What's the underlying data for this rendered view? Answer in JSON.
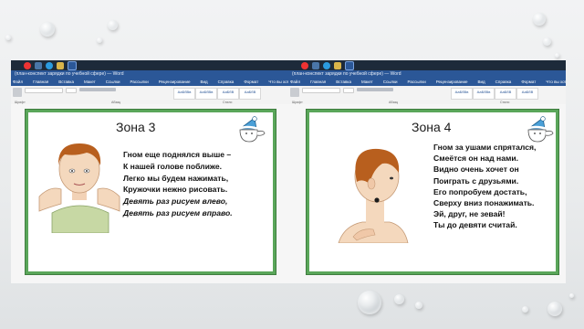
{
  "left": {
    "window_title": "(план-конспект зарядки по учебной сфере) — Word",
    "menu": [
      "Файл",
      "Главная",
      "Вставка",
      "Макет",
      "Ссылки",
      "Рассылки",
      "Рецензирование",
      "Вид",
      "Справка",
      "Формат",
      "Что вы хотите сделать?"
    ],
    "ribbon_groups": [
      "Шрифт",
      "Абзац",
      "Стили"
    ],
    "styles": [
      "АаБбВв",
      "АаБбВв",
      "АаБбВ",
      "АаБбВ"
    ],
    "zone_title": "Зона 3",
    "poem": [
      "Гном еще поднялся выше –",
      "К нашей голове поближе.",
      "Легко мы будем нажимать,",
      "Кружочки нежно рисовать."
    ],
    "poem_italic": [
      "Девять раз рисуем влево,",
      "Девять раз рисуем вправо."
    ]
  },
  "right": {
    "window_title": "(план-конспект зарядки по учебной сфере) — Word",
    "menu": [
      "Файл",
      "Главная",
      "Вставка",
      "Макет",
      "Ссылки",
      "Рассылки",
      "Рецензирование",
      "Вид",
      "Справка",
      "Формат",
      "Что вы хотите сделать?"
    ],
    "ribbon_groups": [
      "Шрифт",
      "Абзац",
      "Стили"
    ],
    "styles": [
      "АаБбВв",
      "АаБбВв",
      "АаБбВ",
      "АаБбВ"
    ],
    "zone_title": "Зона 4",
    "poem": [
      "Гном за ушами спрятался,",
      "Смеётся он над нами.",
      "Видно очень хочет он",
      "Поиграть с друзьями.",
      "Его попробуем достать,",
      "Сверху вниз понажимать.",
      "Эй, друг, не зевай!",
      "Ты до девяти считай."
    ]
  },
  "colors": {
    "card_border": "#5aa65a",
    "word_blue": "#2b5797",
    "hat": "#4aa0d8"
  }
}
